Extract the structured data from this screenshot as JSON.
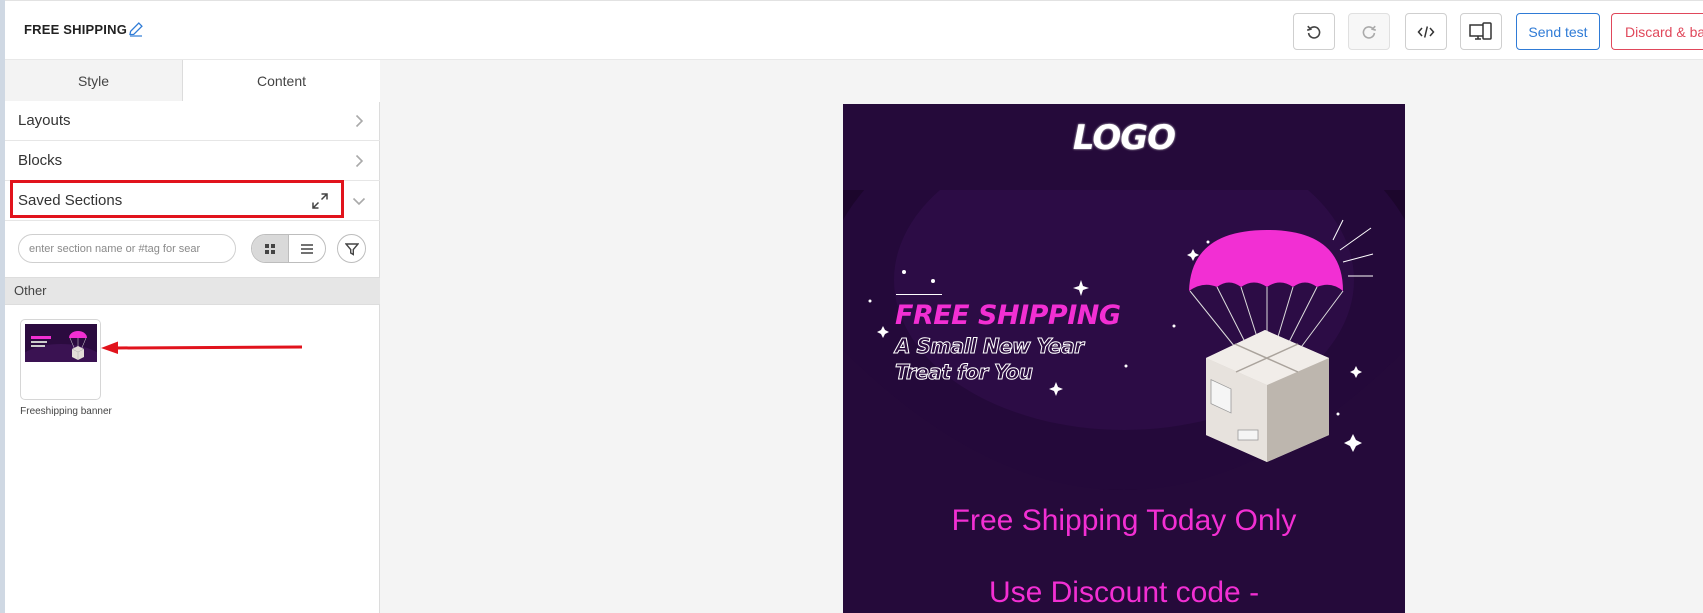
{
  "header": {
    "title": "FREE SHIPPING",
    "send_test_label": "Send test",
    "discard_label": "Discard & back"
  },
  "panel": {
    "tabs": [
      {
        "label": "Style"
      },
      {
        "label": "Content"
      }
    ],
    "sections": [
      {
        "label": "Layouts"
      },
      {
        "label": "Blocks"
      },
      {
        "label": "Saved Sections"
      }
    ],
    "search_placeholder": "enter section name or #tag for sear",
    "group_title": "Other",
    "saved_item": {
      "name": "Freeshipping banner"
    }
  },
  "preview": {
    "logo_text": "LOGO",
    "headline": "FREE SHIPPING",
    "subline_1": "A Small New Year",
    "subline_2": "Treat for You",
    "offer_line_1": "Free Shipping Today Only",
    "offer_line_2": "Use Discount code -"
  },
  "colors": {
    "accent_blue": "#2f7bd6",
    "danger_red": "#e0485b",
    "highlight_red": "#e1131c",
    "brand_pink": "#f22fd3",
    "email_bg": "#250a3a"
  }
}
